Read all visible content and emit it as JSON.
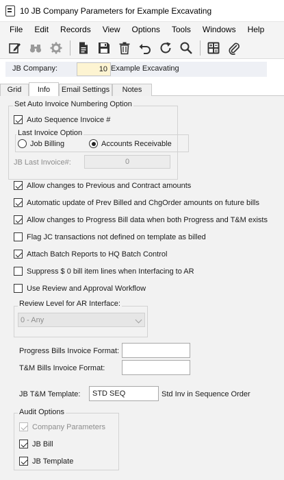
{
  "window": {
    "title": "10 JB Company Parameters for Example Excavating"
  },
  "menu": [
    "File",
    "Edit",
    "Records",
    "View",
    "Options",
    "Tools",
    "Windows",
    "Help"
  ],
  "toolbar": {
    "icons": [
      "edit-icon",
      "binoculars-icon",
      "settings-icon",
      "document-icon",
      "save-icon",
      "delete-icon",
      "undo-icon",
      "refresh-icon",
      "search-icon",
      "calculator-icon",
      "attachment-icon"
    ]
  },
  "company": {
    "label": "JB Company:",
    "code": "10",
    "name": "Example Excavating"
  },
  "tabs": [
    {
      "label": "Grid",
      "active": false
    },
    {
      "label": "Info",
      "active": true
    },
    {
      "label": "Email Settings",
      "active": false
    },
    {
      "label": "Notes",
      "active": false
    }
  ],
  "invoice_group": {
    "legend": "Set Auto Invoice Numbering Option",
    "auto_sequence": {
      "label": "Auto Sequence Invoice #",
      "checked": true
    },
    "last_invoice": {
      "legend": "Last Invoice Option",
      "job_billing": "Job Billing",
      "accounts_receivable": "Accounts Receivable",
      "selected": "Accounts Receivable"
    },
    "jb_last_invoice": {
      "label": "JB Last Invoice#:",
      "value": "0"
    }
  },
  "options": [
    {
      "label": "Allow changes to Previous and Contract amounts",
      "checked": true
    },
    {
      "label": "Automatic update of Prev Billed and ChgOrder amounts on future bills",
      "checked": true
    },
    {
      "label": "Allow changes to Progress Bill data when both Progress and T&M exists",
      "checked": true
    },
    {
      "label": "Flag JC transactions not defined on template as billed",
      "checked": false
    },
    {
      "label": "Attach Batch Reports to HQ Batch Control",
      "checked": true
    },
    {
      "label": "Suppress $ 0 bill item lines when Interfacing to AR",
      "checked": false
    },
    {
      "label": "Use Review and Approval Workflow",
      "checked": false
    }
  ],
  "review": {
    "legend": "Review Level for AR Interface:",
    "value": "0 - Any"
  },
  "formats": {
    "progress_label": "Progress Bills Invoice Format:",
    "progress_value": "",
    "tm_label": "T&M Bills Invoice Format:",
    "tm_value": ""
  },
  "template": {
    "label": "JB T&M Template:",
    "value": "STD SEQ",
    "description": "Std Inv in Sequence Order"
  },
  "audit": {
    "legend": "Audit Options",
    "items": [
      {
        "label": "Company Parameters",
        "checked": true,
        "disabled": true
      },
      {
        "label": "JB Bill",
        "checked": true,
        "disabled": false
      },
      {
        "label": "JB Template",
        "checked": true,
        "disabled": false
      }
    ]
  }
}
